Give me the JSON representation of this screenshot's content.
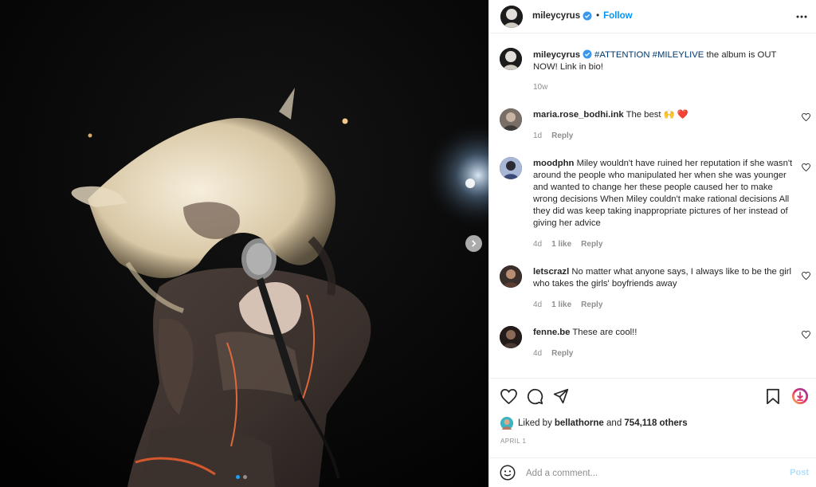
{
  "header": {
    "username": "mileycyrus",
    "separator": "•",
    "follow_label": "Follow"
  },
  "caption": {
    "username": "mileycyrus",
    "hashtag1": "#ATTENTION",
    "hashtag2": "#MILEYLIVE",
    "text": " the album is OUT NOW! Link in bio!",
    "time": "10w"
  },
  "comments": [
    {
      "username": "maria.rose_bodhi.ink",
      "text": "The best 🙌 ❤️",
      "time": "1d",
      "likes": "",
      "reply": "Reply"
    },
    {
      "username": "moodphn",
      "text": "Miley wouldn't have ruined her reputation if she wasn't around the people who manipulated her when she was younger and wanted to change her these people caused her to make wrong decisions When Miley couldn't make rational decisions All they did was keep taking inappropriate pictures of her instead of giving her advice",
      "time": "4d",
      "likes": "1 like",
      "reply": "Reply"
    },
    {
      "username": "letscrazl",
      "text": "No matter what anyone says, I always like to be the girl who takes the girls' boyfriends away",
      "time": "4d",
      "likes": "1 like",
      "reply": "Reply"
    },
    {
      "username": "fenne.be",
      "text": "These are cool!!",
      "time": "4d",
      "likes": "",
      "reply": "Reply"
    }
  ],
  "likes": {
    "prefix": "Liked by ",
    "user": "bellathorne",
    "middle": " and ",
    "count": "754,118 others"
  },
  "date": "APRIL 1",
  "add_comment": {
    "placeholder": "Add a comment...",
    "post_label": "Post"
  },
  "colors": {
    "link_blue": "#0095f6",
    "hashtag": "#00376b",
    "muted": "#8e8e8e",
    "like_red": "#ed4956"
  },
  "icons": [
    "heart-icon",
    "comment-icon",
    "share-icon",
    "bookmark-icon",
    "emoji-icon",
    "more-icon",
    "verified-icon",
    "next-icon"
  ]
}
